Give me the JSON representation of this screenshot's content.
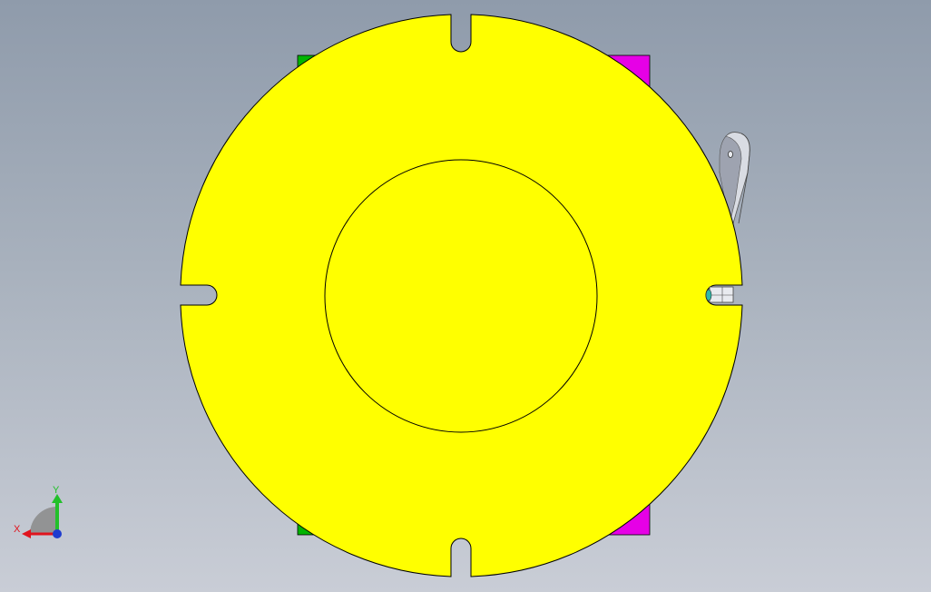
{
  "viewport": {
    "background_top": "#8f9bab",
    "background_bottom": "#c9cdd6"
  },
  "model": {
    "disc_color": "#ffff00",
    "outline_color": "#000000",
    "left_block_color": "#00b400",
    "right_block_color": "#e600e6",
    "arm_color": "#d9dce3",
    "arm_shade_color": "#9ea3b0",
    "pin_color": "#2fb8a8"
  },
  "triad": {
    "x_label": "X",
    "y_label": "Y",
    "x_color": "#e0141e",
    "y_color": "#22c02a",
    "z_color": "#1f3ccf",
    "plane_color": "#8a8a8a"
  }
}
